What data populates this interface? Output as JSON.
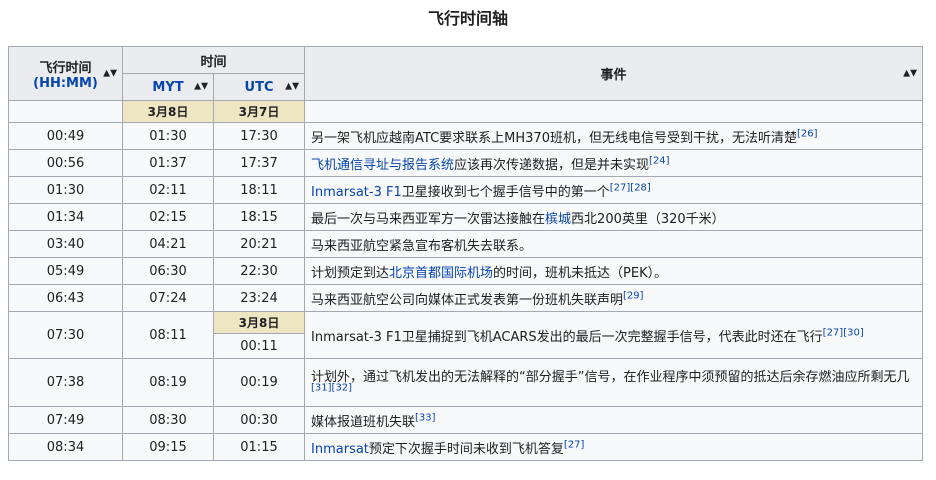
{
  "caption": "飞行时间轴",
  "headers": {
    "flight_time": "飞行时间",
    "flight_time_unit": "(HH:MM)",
    "time": "时间",
    "myt": "MYT",
    "utc": "UTC",
    "event": "事件"
  },
  "date_row": {
    "myt": "3月8日",
    "utc": "3月7日"
  },
  "utc_date_change": "3月8日",
  "rows": [
    {
      "ft": "00:49",
      "myt": "01:30",
      "utc": "17:30",
      "pre": "另一架飞机应越南ATC要求联系上MH370班机，但无线电信号受到干扰，无法听清楚",
      "link": "",
      "post": "",
      "refs": "[26]"
    },
    {
      "ft": "00:56",
      "myt": "01:37",
      "utc": "17:37",
      "pre": "",
      "link": "飞机通信寻址与报告系统",
      "post": "应该再次传递数据，但是并未实现",
      "refs": "[24]"
    },
    {
      "ft": "01:30",
      "myt": "02:11",
      "utc": "18:11",
      "pre": "",
      "link": "Inmarsat-3 F1",
      "post": "卫星接收到七个握手信号中的第一个",
      "refs": "[27][28]"
    },
    {
      "ft": "01:34",
      "myt": "02:15",
      "utc": "18:15",
      "pre": "最后一次与马来西亚军方一次雷达接触在",
      "link": "槟城",
      "post": "西北200英里（320千米）",
      "refs": ""
    },
    {
      "ft": "03:40",
      "myt": "04:21",
      "utc": "20:21",
      "pre": "马来西亚航空紧急宣布客机失去联系。",
      "link": "",
      "post": "",
      "refs": ""
    },
    {
      "ft": "05:49",
      "myt": "06:30",
      "utc": "22:30",
      "pre": "计划预定到达",
      "link": "北京首都国际机场",
      "post": "的时间，班机未抵达（PEK）。",
      "refs": ""
    },
    {
      "ft": "06:43",
      "myt": "07:24",
      "utc": "23:24",
      "pre": "马来西亚航空公司向媒体正式发表第一份班机失联声明",
      "link": "",
      "post": "",
      "refs": "[29]"
    },
    {
      "ft": "07:30",
      "myt": "08:11",
      "utc": "00:11",
      "pre": "",
      "link": "",
      "post": "Inmarsat-3 F1卫星捕捉到飞机ACARS发出的最后一次完整握手信号，代表此时还在飞行",
      "refs": "[27][30]"
    },
    {
      "ft": "07:38",
      "myt": "08:19",
      "utc": "00:19",
      "pre": "计划外，通过飞机发出的无法解释的“部分握手”信号",
      "link": "",
      "post": "，在作业程序中须预留的抵达后余存燃油应所剩无几",
      "refs": "[31][32]"
    },
    {
      "ft": "07:49",
      "myt": "08:30",
      "utc": "00:30",
      "pre": "媒体报道班机失联",
      "link": "",
      "post": "",
      "refs": "[33]"
    },
    {
      "ft": "08:34",
      "myt": "09:15",
      "utc": "01:15",
      "pre": "",
      "link": "Inmarsat",
      "post": "预定下次握手时间未收到飞机答复",
      "refs": "[27]"
    }
  ]
}
